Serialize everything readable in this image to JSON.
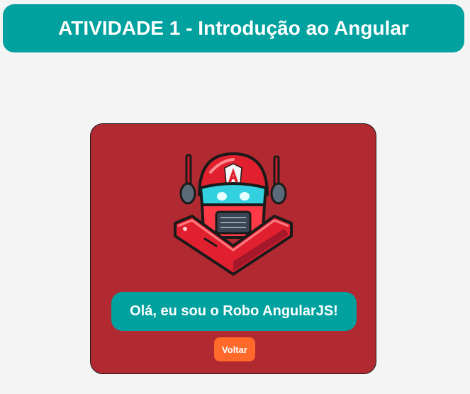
{
  "header": {
    "title": "ATIVIDADE 1 - Introdução ao Angular"
  },
  "card": {
    "speech": "Olá, eu sou o Robo AngularJS!",
    "back_label": "Voltar",
    "robot_image": "angular-robot-mascot"
  },
  "colors": {
    "teal": "#00a19f",
    "card_red": "#b22a31",
    "button_orange": "#ff6a2b",
    "background": "#f4f4f4"
  }
}
